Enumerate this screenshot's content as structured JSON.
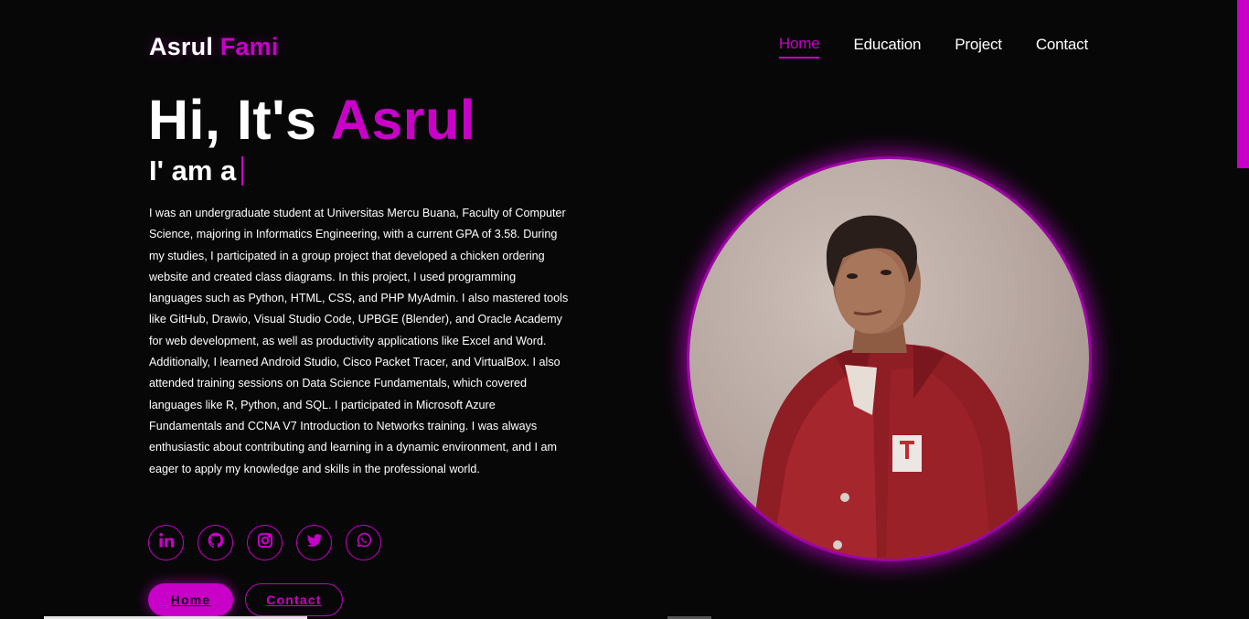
{
  "logo": {
    "first": "Asrul",
    "accent": "Fami"
  },
  "nav": [
    {
      "label": "Home",
      "active": true
    },
    {
      "label": "Education",
      "active": false
    },
    {
      "label": "Project",
      "active": false
    },
    {
      "label": "Contact",
      "active": false
    }
  ],
  "hero": {
    "greeting": "Hi, It's",
    "name": "Asrul",
    "typing_prefix": "I' am a"
  },
  "bio": "I was an undergraduate student at Universitas Mercu Buana, Faculty of Computer Science, majoring in Informatics Engineering, with a current GPA of 3.58. During my studies, I participated in a group project that developed a chicken ordering website and created class diagrams. In this project, I used programming languages such as Python, HTML, CSS, and PHP MyAdmin. I also mastered tools like GitHub, Drawio, Visual Studio Code, UPBGE (Blender), and Oracle Academy for web development, as well as productivity applications like Excel and Word. Additionally, I learned Android Studio, Cisco Packet Tracer, and VirtualBox. I also attended training sessions on Data Science Fundamentals, which covered languages like R, Python, and SQL. I participated in Microsoft Azure Fundamentals and CCNA V7 Introduction to Networks training. I was always enthusiastic about contributing and learning in a dynamic environment, and I am eager to apply my knowledge and skills in the professional world.",
  "socials": [
    {
      "icon": "linkedin-icon"
    },
    {
      "icon": "github-icon"
    },
    {
      "icon": "instagram-icon"
    },
    {
      "icon": "twitter-icon"
    },
    {
      "icon": "whatsapp-icon"
    }
  ],
  "buttons": {
    "primary": "Home",
    "secondary": "Contact"
  },
  "colors": {
    "accent": "#c800c8",
    "background": "#080708",
    "text": "#ffffff"
  }
}
